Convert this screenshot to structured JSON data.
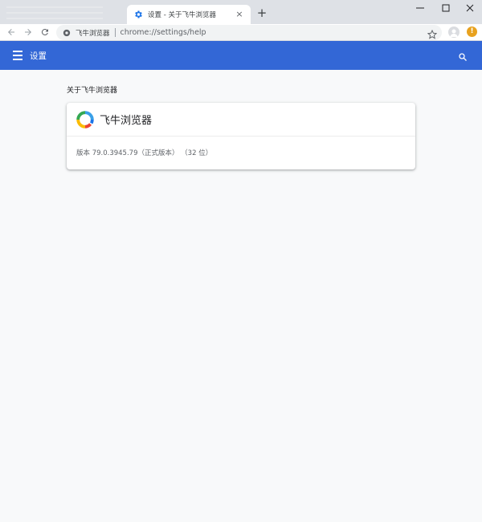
{
  "tab": {
    "title": "设置 - 关于飞牛浏览器",
    "close_glyph": "×",
    "new_tab_glyph": "+"
  },
  "window_controls": {
    "minimize": "—",
    "maximize": "☐",
    "close": "✕"
  },
  "address_bar": {
    "chip_label": "飞牛浏览器",
    "url": "chrome://settings/help"
  },
  "profile": {
    "alert_glyph": "!"
  },
  "header": {
    "title": "设置"
  },
  "about": {
    "section_title": "关于飞牛浏览器",
    "product_name": "飞牛浏览器",
    "version_text": "版本 79.0.3945.79（正式版本）  （32 位）"
  },
  "colors": {
    "accent": "#3367d6",
    "tab_strip": "#dee1e6",
    "page_bg": "#f8f9fa"
  }
}
